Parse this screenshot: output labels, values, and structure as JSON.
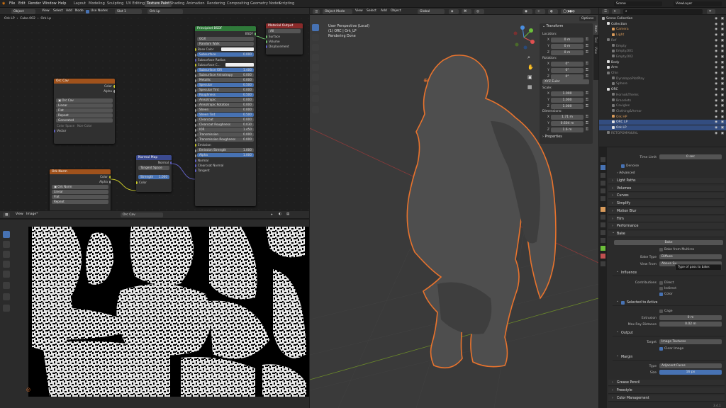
{
  "menu": [
    "File",
    "Edit",
    "Render",
    "Window",
    "Help"
  ],
  "workspaces": [
    "Layout",
    "Modeling",
    "Sculpting",
    "UV Editing",
    "Texture Paint",
    "Shading",
    "Animation",
    "Rendering",
    "Compositing",
    "Geometry Nodes",
    "Scripting"
  ],
  "active_workspace": "Texture Paint",
  "scene": "Scene",
  "view_layer": "ViewLayer",
  "node_header": {
    "mode": "Object",
    "items": [
      "View",
      "Select",
      "Add",
      "Node"
    ],
    "use_nodes": "Use Nodes",
    "slot": "Slot 1",
    "material": "Ork Lp"
  },
  "breadcrumb": [
    "Ork LP",
    "Cube.002",
    "Ork Lp"
  ],
  "nodes": {
    "principled": {
      "title": "Principled BSDF",
      "out": "BSDF",
      "dist": "GGX",
      "sss": "Random Walk",
      "rows": [
        [
          "Base Color",
          ""
        ],
        [
          "Subsurface",
          "0.000"
        ],
        [
          "Subsurface Radius",
          ""
        ],
        [
          "Subsurface C...",
          ""
        ],
        [
          "Subsurface IOR",
          "1.400"
        ],
        [
          "Subsurface Anisotropy",
          "0.000"
        ],
        [
          "Metallic",
          "0.000"
        ],
        [
          "Specular",
          "0.500"
        ],
        [
          "Specular Tint",
          "0.000"
        ],
        [
          "Roughness",
          "0.500"
        ],
        [
          "Anisotropic",
          "0.000"
        ],
        [
          "Anisotropic Rotation",
          "0.000"
        ],
        [
          "Sheen",
          "0.000"
        ],
        [
          "Sheen Tint",
          "0.500"
        ],
        [
          "Clearcoat",
          "0.000"
        ],
        [
          "Clearcoat Roughness",
          "0.030"
        ],
        [
          "IOR",
          "1.450"
        ],
        [
          "Transmission",
          "0.000"
        ],
        [
          "Transmission Roughness",
          "0.000"
        ],
        [
          "Emission",
          ""
        ],
        [
          "Emission Strength",
          "1.000"
        ],
        [
          "Alpha",
          "1.000"
        ],
        [
          "Normal",
          ""
        ],
        [
          "Clearcoat Normal",
          ""
        ],
        [
          "Tangent",
          ""
        ]
      ]
    },
    "output": {
      "title": "Material Output",
      "target": "All",
      "rows": [
        "Surface",
        "Volume",
        "Displacement"
      ]
    },
    "orc_cav": {
      "title": "Orc Cav",
      "outs": [
        "Color",
        "Alpha"
      ],
      "img": "Orc Cav",
      "interp": "Linear",
      "proj": "Flat",
      "ext": "Repeat",
      "src": "Generated",
      "cs_label": "Color Space",
      "cs": "Non-Color",
      "vec": "Vector"
    },
    "normal_map": {
      "title": "Normal Map",
      "out": "Normal",
      "space": "Tangent Space",
      "strength_label": "Strength",
      "strength": "1.000",
      "color": "Color"
    },
    "ork_norm": {
      "title": "Ork Norm",
      "outs": [
        "Color",
        "Alpha"
      ],
      "img": "Ork Norm",
      "interp": "Linear",
      "proj": "Flat",
      "ext": "Repeat"
    }
  },
  "image_editor": {
    "items": [
      "View",
      "Image*"
    ],
    "image": "Orc Cav"
  },
  "viewport": {
    "mode": "Object Mode",
    "items": [
      "View",
      "Select",
      "Add",
      "Object"
    ],
    "orient": "Global",
    "info": [
      "User Perspective (Local)",
      "(1) ORC | Ork_LP",
      "Rendering Done"
    ],
    "options": "Options"
  },
  "npanel": {
    "tabs": [
      "Item",
      "Tool",
      "View"
    ],
    "title": "Transform",
    "location": "Location:",
    "loc": [
      "0 m",
      "0 m",
      "0 m"
    ],
    "rotation": "Rotation:",
    "rot": [
      "0°",
      "0°",
      "0°"
    ],
    "euler": "XYZ Euler",
    "scale": "Scale:",
    "scl": [
      "1.000",
      "1.000",
      "1.000"
    ],
    "dimensions": "Dimensions:",
    "dim": [
      "1.71 m",
      "0.604 m",
      "1.6 m"
    ],
    "properties": "Properties",
    "axes": [
      "X",
      "Y",
      "Z"
    ]
  },
  "outliner": {
    "search": "",
    "items": [
      [
        "Scene Collection",
        0,
        "#ddd",
        false
      ],
      [
        "Collection",
        1,
        "#ddd",
        false
      ],
      [
        "Camera",
        2,
        "#d89a5a",
        false
      ],
      [
        "Light",
        2,
        "#d89a5a",
        false
      ],
      [
        "Ref",
        1,
        "#8a8a8a",
        false
      ],
      [
        "Empty",
        2,
        "#8a8a8a",
        false
      ],
      [
        "Empty.001",
        2,
        "#8a8a8a",
        false
      ],
      [
        "Empty.002",
        2,
        "#8a8a8a",
        false
      ],
      [
        "Body",
        1,
        "#ddd",
        false
      ],
      [
        "Arm",
        1,
        "#ddd",
        false
      ],
      [
        "Chin",
        1,
        "#8a8a8a",
        false
      ],
      [
        "DynatopoPlotPlay",
        2,
        "#8a8a8a",
        false
      ],
      [
        "Sphere",
        2,
        "#8a8a8a",
        false
      ],
      [
        "ORC",
        1,
        "#ddd",
        false
      ],
      [
        "Horns&Thems",
        2,
        "#8a8a8a",
        false
      ],
      [
        "Bracelets",
        2,
        "#8a8a8a",
        false
      ],
      [
        "Cavigles",
        2,
        "#8a8a8a",
        false
      ],
      [
        "Clothing&Armor",
        2,
        "#8a8a8a",
        false
      ],
      [
        "Ork HP",
        2,
        "#d89a5a",
        false
      ],
      [
        "ORC LP",
        2,
        "#e0e0e0",
        true
      ],
      [
        "Ork LP",
        2,
        "#e0e0e0",
        true
      ],
      [
        "RETOPOMANUAL",
        1,
        "#8a8a8a",
        false
      ]
    ]
  },
  "props": {
    "time_limit_label": "Time Limit",
    "time_limit": "0 sec",
    "denoise": "Denoise",
    "advanced": "Advanced",
    "sections": [
      "Light Paths",
      "Volumes",
      "Curves",
      "Simplify",
      "Motion Blur",
      "Film",
      "Performance"
    ],
    "bake": "Bake",
    "bake_btn": "Bake",
    "from_multires": "Bake from Multires",
    "bake_type_label": "Bake Type",
    "bake_type": "Diffuse",
    "view_from_label": "View From",
    "view_from": "Above Su",
    "tooltip": "Type of pass to bake: Diffuse",
    "influence": "Influence",
    "contrib": "Contributions",
    "direct": "Direct",
    "indirect": "Indirect",
    "color": "Color",
    "sel_active": "Selected to Active",
    "cage": "Cage",
    "extrusion_label": "Extrusion",
    "extrusion": "0 m",
    "maxray_label": "Max Ray Distance",
    "maxray": "0.02 m",
    "output": "Output",
    "target_label": "Target",
    "target": "Image Textures",
    "clear_image": "Clear Image",
    "margin": "Margin",
    "type_label": "Type",
    "type": "Adjacent Faces",
    "size_label": "Size",
    "size": "16 px",
    "bottom": [
      "Grease Pencil",
      "Freestyle",
      "Color Management"
    ]
  },
  "version": "3.4.1",
  "colors": {
    "accent": "#4772b3",
    "outline": "#e8732d",
    "node_green": "#2f7a3a",
    "node_orange": "#a0521c",
    "node_blue": "#3b4a8f",
    "node_red": "#8a2a2a"
  }
}
